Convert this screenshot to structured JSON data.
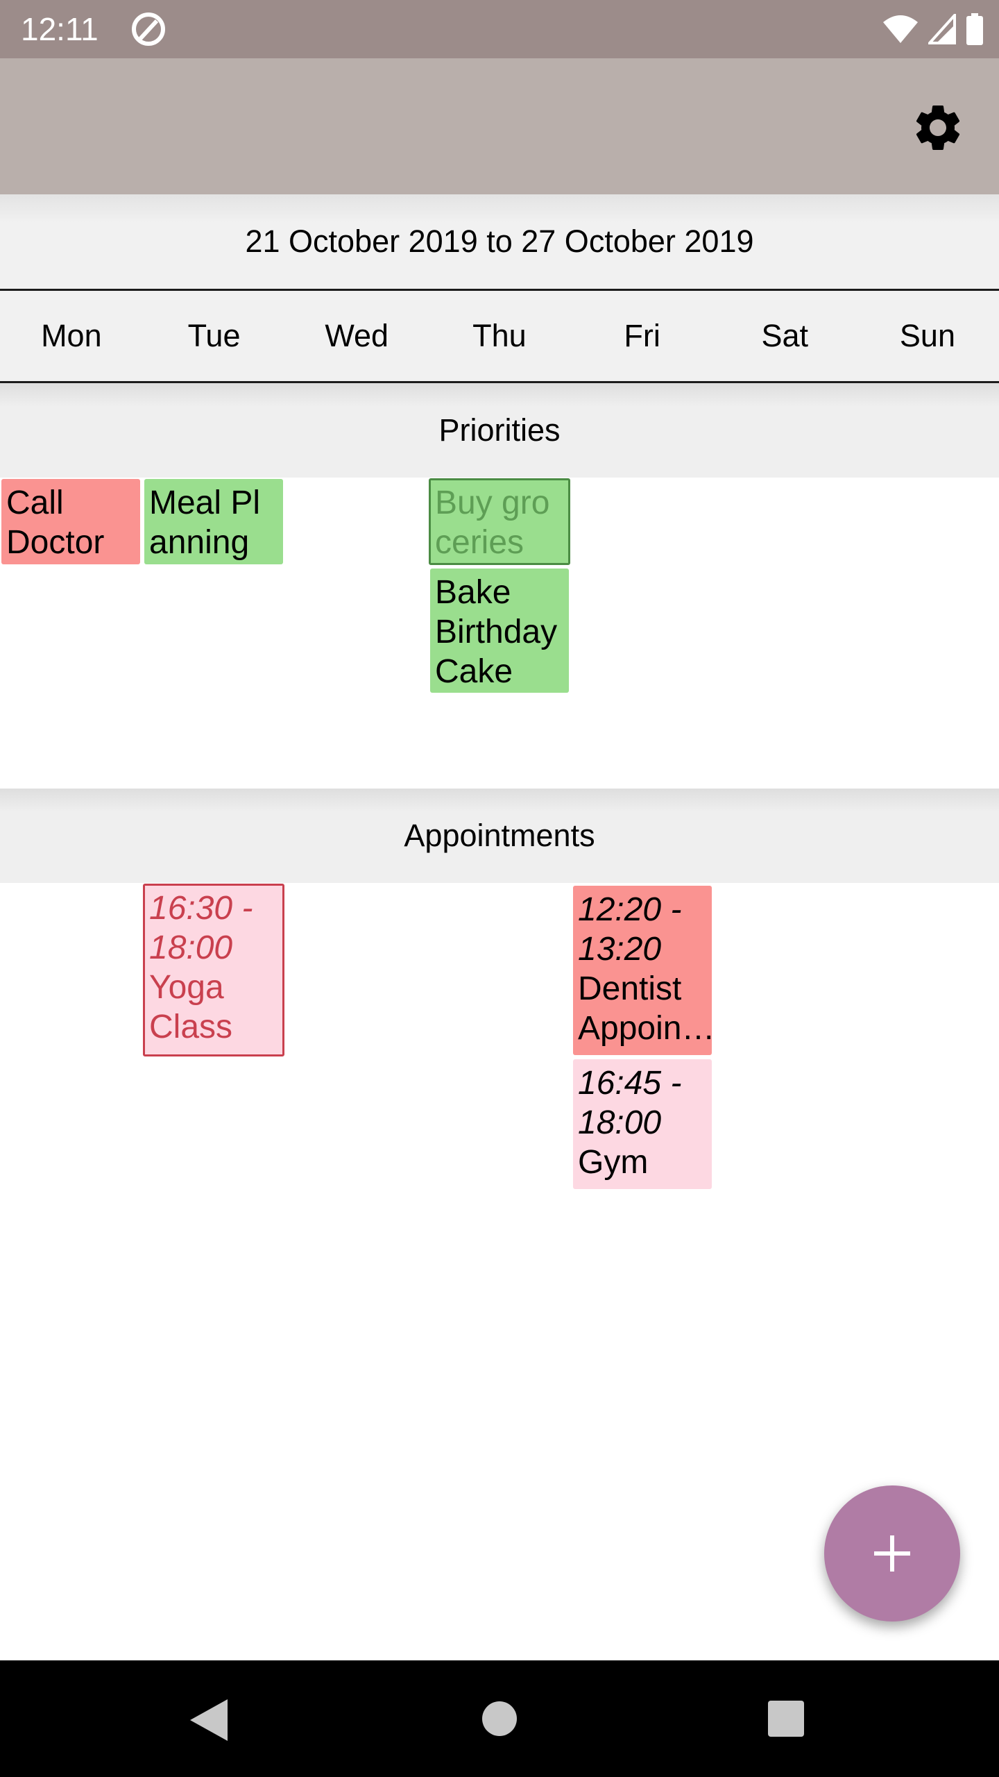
{
  "status_bar": {
    "time": "12:11"
  },
  "date_range": "21 October 2019 to 27 October 2019",
  "days": [
    "Mon",
    "Tue",
    "Wed",
    "Thu",
    "Fri",
    "Sat",
    "Sun"
  ],
  "priorities": {
    "header": "Priorities",
    "items": [
      {
        "day": "Mon",
        "lines": [
          "Call",
          "Doctor"
        ],
        "color": "#fa9391"
      },
      {
        "day": "Tue",
        "lines": [
          "Meal Pl",
          "anning"
        ],
        "color": "#9ade8e"
      },
      {
        "day": "Thu",
        "lines": [
          "Buy gro",
          "ceries"
        ],
        "color": "#9ade8e",
        "state": "selected"
      },
      {
        "day": "Thu",
        "lines": [
          "Bake",
          "Birthday",
          "Cake"
        ],
        "color": "#9ade8e"
      }
    ]
  },
  "appointments": {
    "header": "Appointments",
    "items": [
      {
        "day": "Tue",
        "time_lines": [
          "16:30 -",
          "18:00"
        ],
        "title_lines": [
          "Yoga",
          "Class"
        ],
        "color": "#fdd8e2",
        "state": "outlined"
      },
      {
        "day": "Fri",
        "time_lines": [
          "12:20 -",
          "13:20"
        ],
        "title_lines": [
          "Dentist",
          "Appoin…"
        ],
        "color": "#fa9391"
      },
      {
        "day": "Fri",
        "time_lines": [
          "16:45 -",
          "18:00"
        ],
        "title_lines": [
          "Gym"
        ],
        "color": "#fdd8e2"
      }
    ]
  },
  "colors": {
    "status_bar": "#9c8c8a",
    "app_bar": "#b9afab",
    "fab": "#b07ca5",
    "priority_red": "#fa9391",
    "priority_green": "#9ade8e",
    "appointment_pink": "#fdd8e2",
    "appointment_outline": "#c9404e"
  },
  "icons": {
    "settings": "gear-icon",
    "fab": "plus-icon",
    "nav_back": "back-triangle-icon",
    "nav_home": "home-circle-icon",
    "nav_recents": "recents-square-icon"
  }
}
